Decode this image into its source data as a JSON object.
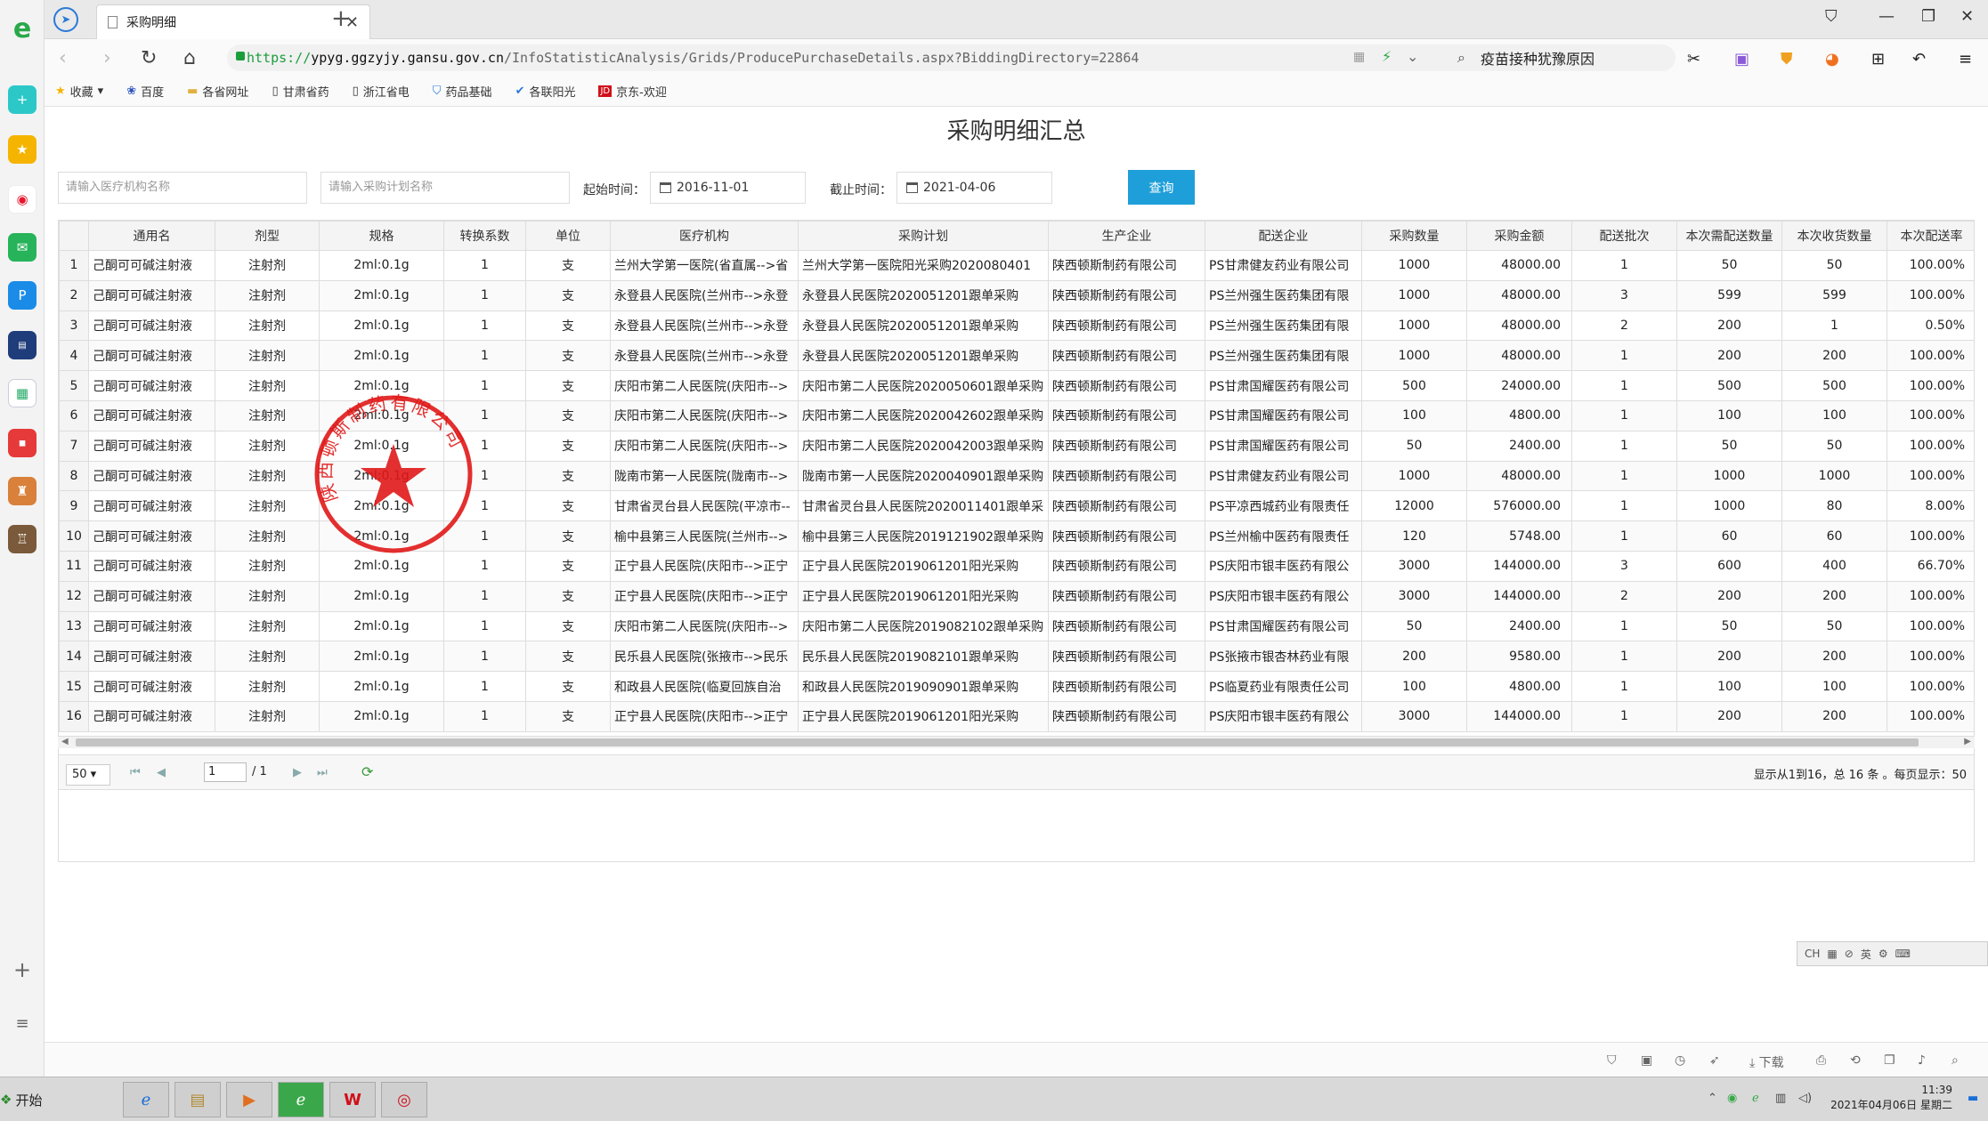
{
  "browser": {
    "tab_title": "采购明细",
    "url_proto": "https://",
    "url_host": "ypyg.ggzyjy.gansu.gov.cn",
    "url_path": "/InfoStatisticAnalysis/Grids/ProducePurchaseDetails.aspx?BiddingDirectory=22864",
    "search_text": "疫苗接种犹豫原因",
    "bookmarks": [
      "收藏",
      "百度",
      "各省网址",
      "甘肃省药",
      "浙江省电",
      "药品基础",
      "各联阳光",
      "京东-欢迎"
    ]
  },
  "page": {
    "title": "采购明细汇总",
    "filters": {
      "org_placeholder": "请输入医疗机构名称",
      "plan_placeholder": "请输入采购计划名称",
      "start_label": "起始时间：",
      "start_value": "2016-11-01",
      "end_label": "截止时间：",
      "end_value": "2021-04-06",
      "query_label": "查询"
    },
    "columns": [
      "通用名",
      "剂型",
      "规格",
      "转换系数",
      "单位",
      "医疗机构",
      "采购计划",
      "生产企业",
      "配送企业",
      "采购数量",
      "采购金额",
      "配送批次",
      "本次需配送数量",
      "本次收货数量",
      "本次配送率"
    ],
    "rows": [
      [
        "1",
        "己酮可可碱注射液",
        "注射剂",
        "2ml:0.1g",
        "1",
        "支",
        "兰州大学第一医院(省直属-->省",
        "兰州大学第一医院阳光采购2020080401",
        "陕西顿斯制药有限公司",
        "PS甘肃健友药业有限公司",
        "1000",
        "48000.00",
        "1",
        "50",
        "50",
        "100.00%"
      ],
      [
        "2",
        "己酮可可碱注射液",
        "注射剂",
        "2ml:0.1g",
        "1",
        "支",
        "永登县人民医院(兰州市-->永登",
        "永登县人民医院2020051201跟单采购",
        "陕西顿斯制药有限公司",
        "PS兰州强生医药集团有限",
        "1000",
        "48000.00",
        "3",
        "599",
        "599",
        "100.00%"
      ],
      [
        "3",
        "己酮可可碱注射液",
        "注射剂",
        "2ml:0.1g",
        "1",
        "支",
        "永登县人民医院(兰州市-->永登",
        "永登县人民医院2020051201跟单采购",
        "陕西顿斯制药有限公司",
        "PS兰州强生医药集团有限",
        "1000",
        "48000.00",
        "2",
        "200",
        "1",
        "0.50%"
      ],
      [
        "4",
        "己酮可可碱注射液",
        "注射剂",
        "2ml:0.1g",
        "1",
        "支",
        "永登县人民医院(兰州市-->永登",
        "永登县人民医院2020051201跟单采购",
        "陕西顿斯制药有限公司",
        "PS兰州强生医药集团有限",
        "1000",
        "48000.00",
        "1",
        "200",
        "200",
        "100.00%"
      ],
      [
        "5",
        "己酮可可碱注射液",
        "注射剂",
        "2ml:0.1g",
        "1",
        "支",
        "庆阳市第二人民医院(庆阳市-->",
        "庆阳市第二人民医院2020050601跟单采购",
        "陕西顿斯制药有限公司",
        "PS甘肃国耀医药有限公司",
        "500",
        "24000.00",
        "1",
        "500",
        "500",
        "100.00%"
      ],
      [
        "6",
        "己酮可可碱注射液",
        "注射剂",
        "2ml:0.1g",
        "1",
        "支",
        "庆阳市第二人民医院(庆阳市-->",
        "庆阳市第二人民医院2020042602跟单采购",
        "陕西顿斯制药有限公司",
        "PS甘肃国耀医药有限公司",
        "100",
        "4800.00",
        "1",
        "100",
        "100",
        "100.00%"
      ],
      [
        "7",
        "己酮可可碱注射液",
        "注射剂",
        "2ml:0.1g",
        "1",
        "支",
        "庆阳市第二人民医院(庆阳市-->",
        "庆阳市第二人民医院2020042003跟单采购",
        "陕西顿斯制药有限公司",
        "PS甘肃国耀医药有限公司",
        "50",
        "2400.00",
        "1",
        "50",
        "50",
        "100.00%"
      ],
      [
        "8",
        "己酮可可碱注射液",
        "注射剂",
        "2ml:0.1g",
        "1",
        "支",
        "陇南市第一人民医院(陇南市-->",
        "陇南市第一人民医院2020040901跟单采购",
        "陕西顿斯制药有限公司",
        "PS甘肃健友药业有限公司",
        "1000",
        "48000.00",
        "1",
        "1000",
        "1000",
        "100.00%"
      ],
      [
        "9",
        "己酮可可碱注射液",
        "注射剂",
        "2ml:0.1g",
        "1",
        "支",
        "甘肃省灵台县人民医院(平凉市--",
        "甘肃省灵台县人民医院2020011401跟单采",
        "陕西顿斯制药有限公司",
        "PS平凉西城药业有限责任",
        "12000",
        "576000.00",
        "1",
        "1000",
        "80",
        "8.00%"
      ],
      [
        "10",
        "己酮可可碱注射液",
        "注射剂",
        "2ml:0.1g",
        "1",
        "支",
        "榆中县第三人民医院(兰州市-->",
        "榆中县第三人民医院2019121902跟单采购",
        "陕西顿斯制药有限公司",
        "PS兰州榆中医药有限责任",
        "120",
        "5748.00",
        "1",
        "60",
        "60",
        "100.00%"
      ],
      [
        "11",
        "己酮可可碱注射液",
        "注射剂",
        "2ml:0.1g",
        "1",
        "支",
        "正宁县人民医院(庆阳市-->正宁",
        "正宁县人民医院2019061201阳光采购",
        "陕西顿斯制药有限公司",
        "PS庆阳市银丰医药有限公",
        "3000",
        "144000.00",
        "3",
        "600",
        "400",
        "66.70%"
      ],
      [
        "12",
        "己酮可可碱注射液",
        "注射剂",
        "2ml:0.1g",
        "1",
        "支",
        "正宁县人民医院(庆阳市-->正宁",
        "正宁县人民医院2019061201阳光采购",
        "陕西顿斯制药有限公司",
        "PS庆阳市银丰医药有限公",
        "3000",
        "144000.00",
        "2",
        "200",
        "200",
        "100.00%"
      ],
      [
        "13",
        "己酮可可碱注射液",
        "注射剂",
        "2ml:0.1g",
        "1",
        "支",
        "庆阳市第二人民医院(庆阳市-->",
        "庆阳市第二人民医院2019082102跟单采购",
        "陕西顿斯制药有限公司",
        "PS甘肃国耀医药有限公司",
        "50",
        "2400.00",
        "1",
        "50",
        "50",
        "100.00%"
      ],
      [
        "14",
        "己酮可可碱注射液",
        "注射剂",
        "2ml:0.1g",
        "1",
        "支",
        "民乐县人民医院(张掖市-->民乐",
        "民乐县人民医院2019082101跟单采购",
        "陕西顿斯制药有限公司",
        "PS张掖市银杏林药业有限",
        "200",
        "9580.00",
        "1",
        "200",
        "200",
        "100.00%"
      ],
      [
        "15",
        "己酮可可碱注射液",
        "注射剂",
        "2ml:0.1g",
        "1",
        "支",
        "和政县人民医院(临夏回族自治",
        "和政县人民医院2019090901跟单采购",
        "陕西顿斯制药有限公司",
        "PS临夏药业有限责任公司",
        "100",
        "4800.00",
        "1",
        "100",
        "100",
        "100.00%"
      ],
      [
        "16",
        "己酮可可碱注射液",
        "注射剂",
        "2ml:0.1g",
        "1",
        "支",
        "正宁县人民医院(庆阳市-->正宁",
        "正宁县人民医院2019061201阳光采购",
        "陕西顿斯制药有限公司",
        "PS庆阳市银丰医药有限公",
        "3000",
        "144000.00",
        "1",
        "200",
        "200",
        "100.00%"
      ]
    ],
    "pager": {
      "page_size": "50",
      "page_current": "1",
      "page_total": "/ 1",
      "info": "显示从1到16，总 16 条 。每页显示：50"
    },
    "stamp_text": "陕西顿斯制药有限公司"
  },
  "ime": {
    "label": "CH",
    "lang": "英"
  },
  "statusbar": {
    "download": "下载"
  },
  "taskbar": {
    "start_label": "开始",
    "clock_time": "11:39",
    "clock_date": "2021年04月06日 星期二"
  }
}
